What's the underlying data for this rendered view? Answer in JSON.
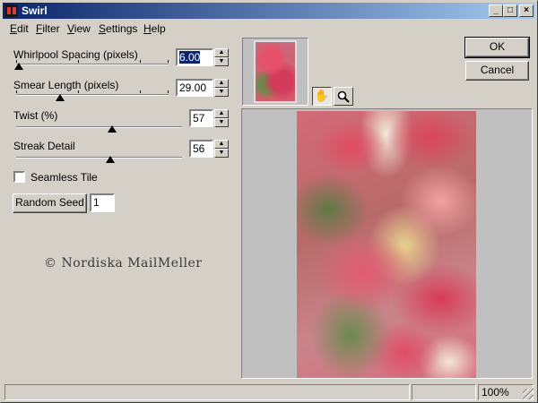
{
  "window": {
    "title": "Swirl",
    "min_glyph": "_",
    "max_glyph": "□",
    "close_glyph": "×"
  },
  "menu": [
    {
      "label": "Edit"
    },
    {
      "label": "Filter"
    },
    {
      "label": "View"
    },
    {
      "label": "Settings"
    },
    {
      "label": "Help"
    }
  ],
  "controls": {
    "whirlpool": {
      "label": "Whirlpool Spacing (pixels)",
      "value": "6.00",
      "level": 0.0
    },
    "smear": {
      "label": "Smear Length (pixels)",
      "value": "29.00",
      "level": 0.29
    },
    "twist": {
      "label": "Twist (%)",
      "value": "57",
      "level": 0.57
    },
    "streak": {
      "label": "Streak Detail",
      "value": "56",
      "level": 0.56
    },
    "seamless": {
      "label": "Seamless Tile",
      "checked": false
    },
    "random_seed": {
      "button": "Random Seed",
      "value": "1"
    }
  },
  "buttons": {
    "ok": "OK",
    "cancel": "Cancel"
  },
  "tools": {
    "hand": "hand-tool-icon",
    "zoom": "magnifier-icon"
  },
  "watermark": "© Nordiska MailMeller",
  "status": {
    "zoom": "100%"
  },
  "colors": {
    "title_bar_start": "#0a246a",
    "title_bar_end": "#a6caf0",
    "face": "#d4d0c8",
    "selection": "#0a246a"
  }
}
